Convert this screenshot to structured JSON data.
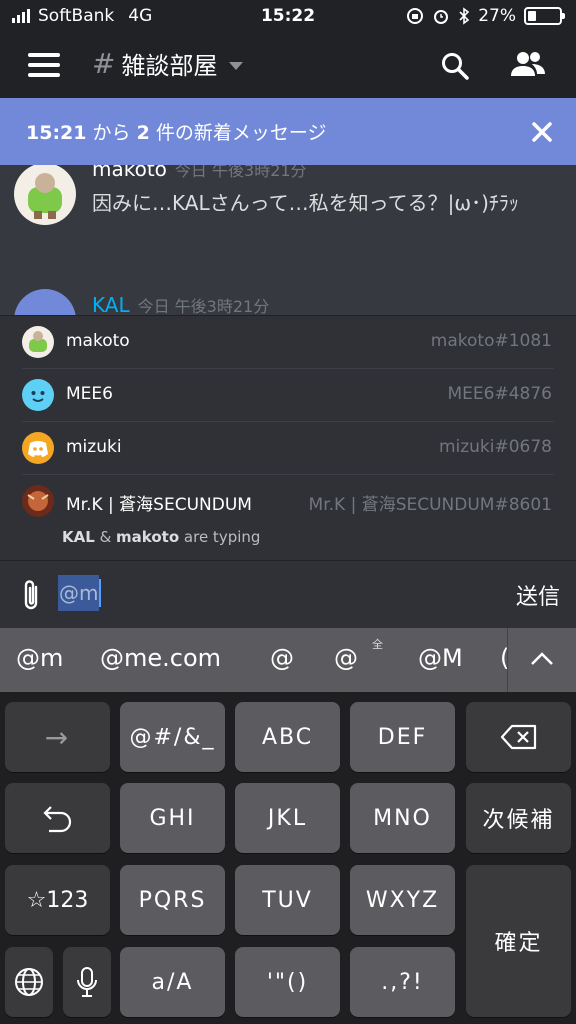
{
  "status_bar": {
    "carrier": "SoftBank",
    "network": "4G",
    "time": "15:22",
    "battery": "27%",
    "battery_level": 0.27
  },
  "header": {
    "channel_hash": "#",
    "channel_name": "雑談部屋",
    "menu_icon": "hamburger-icon",
    "search_icon": "search-icon",
    "members_icon": "members-icon"
  },
  "new_messages_bar": {
    "time": "15:21",
    "from": " から ",
    "count": "2",
    "suffix": " 件の新着メッセージ",
    "close_icon": "close-icon"
  },
  "messages": [
    {
      "author": "makoto",
      "timestamp": "今日 午後3時21分",
      "text": "因みに…KALさんって…私を知ってる？|ω･)ﾁﾗｯ"
    },
    {
      "author": "KAL",
      "timestamp": "今日 午後3時21分",
      "author_color": "#00b0f4"
    }
  ],
  "mention_list": [
    {
      "name": "makoto",
      "tag": "makoto#1081"
    },
    {
      "name": "MEE6",
      "tag": "MEE6#4876"
    },
    {
      "name": "mizuki",
      "tag": "mizuki#0678"
    },
    {
      "name": "Mr.K | 蒼海SECUNDUM",
      "tag": "Mr.K | 蒼海SECUNDUM#8601"
    }
  ],
  "typing": {
    "user1": "KAL",
    "amp": " & ",
    "user2": "makoto",
    "suffix": " are typing"
  },
  "input": {
    "value": "@m",
    "send_label": "送信",
    "attach_icon": "paperclip-icon"
  },
  "keyboard": {
    "suggestions": [
      "@m",
      "@me.com",
      "@",
      "@",
      "@M",
      "("
    ],
    "zenkaku_mark": "全",
    "keys": {
      "arrow": "→",
      "symbols": "@#/&_",
      "abc": "ABC",
      "def": "DEF",
      "backspace": "backspace-icon",
      "undo": "undo-icon",
      "ghi": "GHI",
      "jkl": "JKL",
      "mno": "MNO",
      "next_candidate": "次候補",
      "num": "☆123",
      "pqrs": "PQRS",
      "tuv": "TUV",
      "wxyz": "WXYZ",
      "confirm": "確定",
      "globe": "globe-icon",
      "mic": "mic-icon",
      "case": "a/A",
      "quotes": "'\"()",
      "punct": ".,?!"
    }
  },
  "colors": {
    "accent": "#7289da",
    "background": "#36393f",
    "header": "#202225"
  }
}
